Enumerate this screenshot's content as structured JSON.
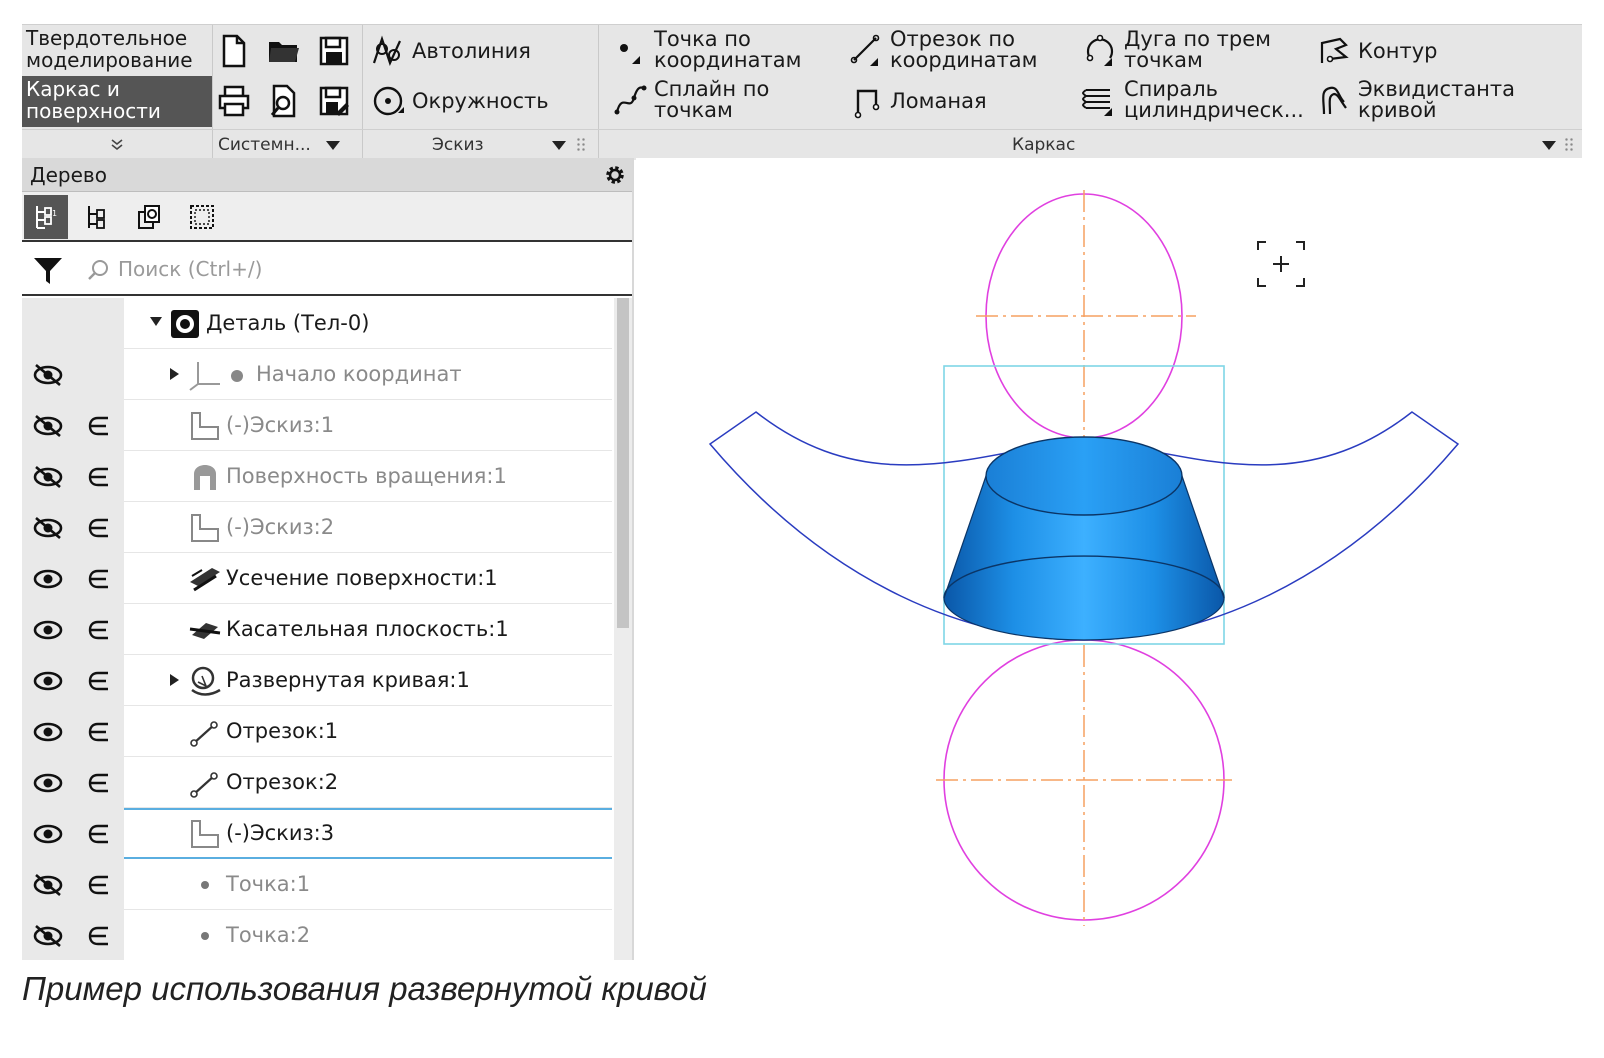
{
  "ribbon": {
    "modes": [
      "Твердотельное моделирование",
      "Каркас и поверхности"
    ],
    "system_group": {
      "label": "Системн..."
    },
    "sketch_group": {
      "label": "Эскиз",
      "items": [
        "Автолиния",
        "Окружность"
      ]
    },
    "wireframe_group": {
      "label": "Каркас",
      "items": [
        "Точка по\nкоординатам",
        "Сплайн по\nточкам",
        "Отрезок по\nкоординатам",
        "Ломаная",
        "Дуга по трем\nточкам",
        "Спираль\nцилиндрическ...",
        "Контур",
        "Эквидистанта\nкривой"
      ]
    }
  },
  "tree": {
    "title": "Дерево",
    "search_placeholder": "Поиск (Ctrl+/)",
    "rows": [
      {
        "label": "Деталь (Тел-0)",
        "icon": "part-icon",
        "visible": null,
        "expander": "open",
        "dim": false
      },
      {
        "label": "Начало координат",
        "icon": "origin-icon",
        "visible": false,
        "expander": "closed",
        "dim": true
      },
      {
        "label": "(-)Эскиз:1",
        "icon": "sketch-icon",
        "visible": false,
        "expander": null,
        "dim": true
      },
      {
        "label": "Поверхность вращения:1",
        "icon": "revolve-surface-icon",
        "visible": false,
        "expander": null,
        "dim": true
      },
      {
        "label": "(-)Эскиз:2",
        "icon": "sketch-icon",
        "visible": false,
        "expander": null,
        "dim": true
      },
      {
        "label": "Усечение поверхности:1",
        "icon": "trim-surface-icon",
        "visible": true,
        "expander": null,
        "dim": false
      },
      {
        "label": "Касательная плоскость:1",
        "icon": "tangent-plane-icon",
        "visible": true,
        "expander": null,
        "dim": false
      },
      {
        "label": "Развернутая кривая:1",
        "icon": "unfolded-curve-icon",
        "visible": true,
        "expander": "closed",
        "dim": false
      },
      {
        "label": "Отрезок:1",
        "icon": "segment-icon",
        "visible": true,
        "expander": null,
        "dim": false
      },
      {
        "label": "Отрезок:2",
        "icon": "segment-icon",
        "visible": true,
        "expander": null,
        "dim": false
      },
      {
        "label": "(-)Эскиз:3",
        "icon": "sketch-icon",
        "visible": true,
        "expander": null,
        "dim": false
      },
      {
        "label": "Точка:1",
        "icon": "point-icon",
        "visible": false,
        "expander": null,
        "dim": true
      },
      {
        "label": "Точка:2",
        "icon": "point-icon",
        "visible": false,
        "expander": null,
        "dim": true
      }
    ],
    "selected_row": 10
  },
  "colors": {
    "accent_blue": "#1e90e6",
    "construction_orange": "#f5a060",
    "sketch_magenta": "#e040e0",
    "curve_navy": "#2a3cc0",
    "bbox_cyan": "#7fd6e6",
    "selection_line": "#5aaee0"
  },
  "caption": "Пример использования развернутой кривой"
}
